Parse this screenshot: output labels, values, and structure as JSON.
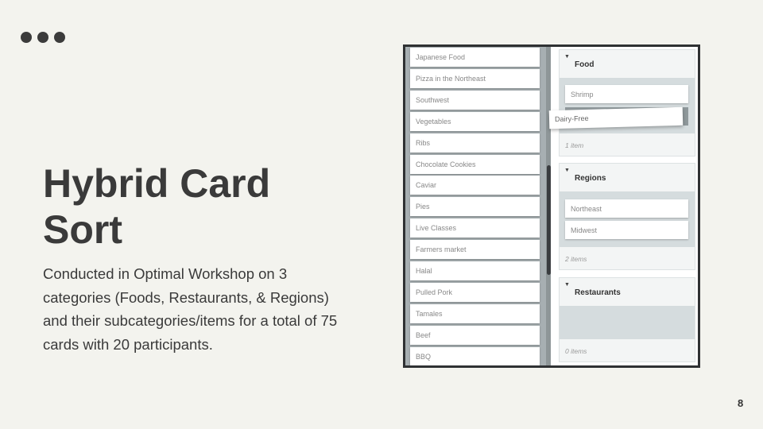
{
  "slide": {
    "title": "Hybrid Card Sort",
    "description": "Conducted in Optimal Workshop on 3 categories (Foods, Restaurants, & Regions) and their subcategories/items for a total of 75 cards with 20 participants.",
    "page_number": "8"
  },
  "cards": [
    "Japanese Food",
    "Pizza in the Northeast",
    "Southwest",
    "Vegetables",
    "Ribs",
    "Chocolate Cookies",
    "Caviar",
    "Pies",
    "Live Classes",
    "Farmers market",
    "Halal",
    "Pulled Pork",
    "Tamales",
    "Beef",
    "BBQ"
  ],
  "categories": [
    {
      "name": "Food",
      "items": [
        "Shrimp"
      ],
      "count": "1 item"
    },
    {
      "name": "Regions",
      "items": [
        "Northeast",
        "Midwest"
      ],
      "count": "2 items"
    },
    {
      "name": "Restaurants",
      "items": [],
      "count": "0 items"
    }
  ],
  "dragging_card": "Dairy-Free"
}
